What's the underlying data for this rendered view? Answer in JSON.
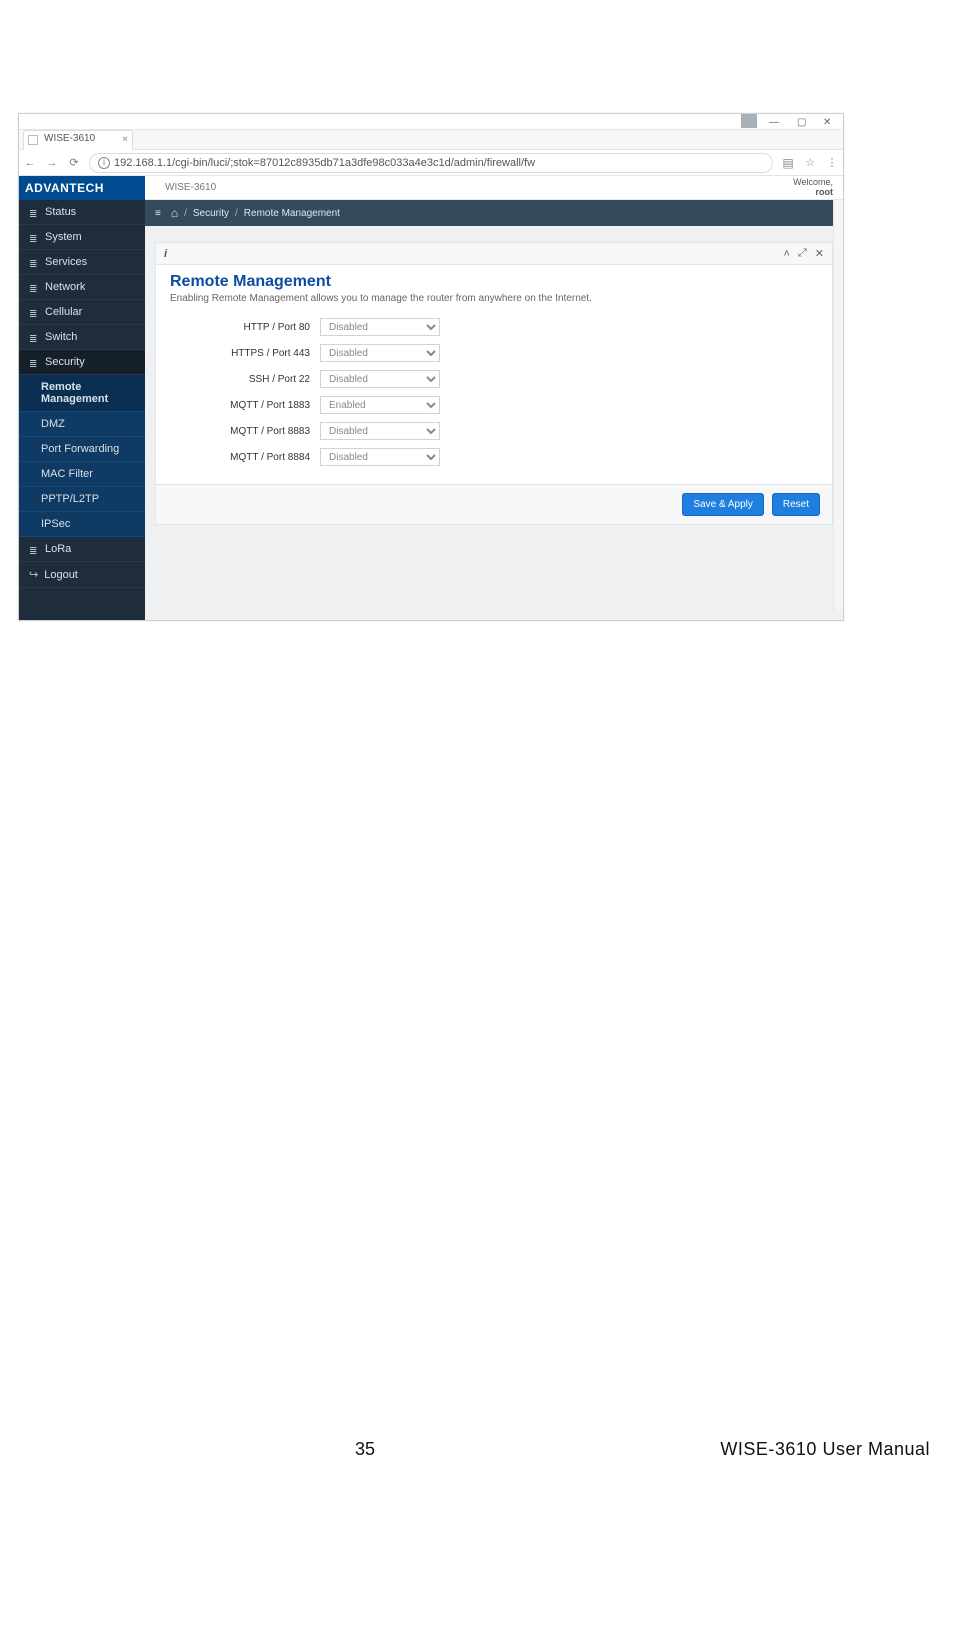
{
  "browser": {
    "tab_title": "WISE-3610",
    "url": "192.168.1.1/cgi-bin/luci/;stok=87012c8935db71a3dfe98c033a4e3c1d/admin/firewall/fw"
  },
  "brand": "ADVANTECH",
  "device_name": "WISE-3610",
  "welcome": {
    "line1": "Welcome,",
    "user": "root"
  },
  "sidebar": {
    "items": [
      {
        "label": "Status"
      },
      {
        "label": "System"
      },
      {
        "label": "Services"
      },
      {
        "label": "Network"
      },
      {
        "label": "Cellular"
      },
      {
        "label": "Switch"
      },
      {
        "label": "Security"
      },
      {
        "label": "LoRa"
      },
      {
        "label": "Logout"
      }
    ],
    "security_sub": [
      {
        "label": "Remote Management"
      },
      {
        "label": "DMZ"
      },
      {
        "label": "Port Forwarding"
      },
      {
        "label": "MAC Filter"
      },
      {
        "label": "PPTP/L2TP"
      },
      {
        "label": "IPSec"
      }
    ]
  },
  "breadcrumb": {
    "section": "Security",
    "page": "Remote Management"
  },
  "panel": {
    "title": "Remote Management",
    "subtitle": "Enabling Remote Management allows you to manage the router from anywhere on the Internet.",
    "rows": [
      {
        "label": "HTTP / Port 80",
        "value": "Disabled"
      },
      {
        "label": "HTTPS / Port 443",
        "value": "Disabled"
      },
      {
        "label": "SSH / Port 22",
        "value": "Disabled"
      },
      {
        "label": "MQTT / Port 1883",
        "value": "Enabled"
      },
      {
        "label": "MQTT / Port 8883",
        "value": "Disabled"
      },
      {
        "label": "MQTT / Port 8884",
        "value": "Disabled"
      }
    ],
    "buttons": {
      "save": "Save & Apply",
      "reset": "Reset"
    }
  },
  "doc_footer": {
    "page_no": "35",
    "title": "WISE-3610  User  Manual"
  }
}
